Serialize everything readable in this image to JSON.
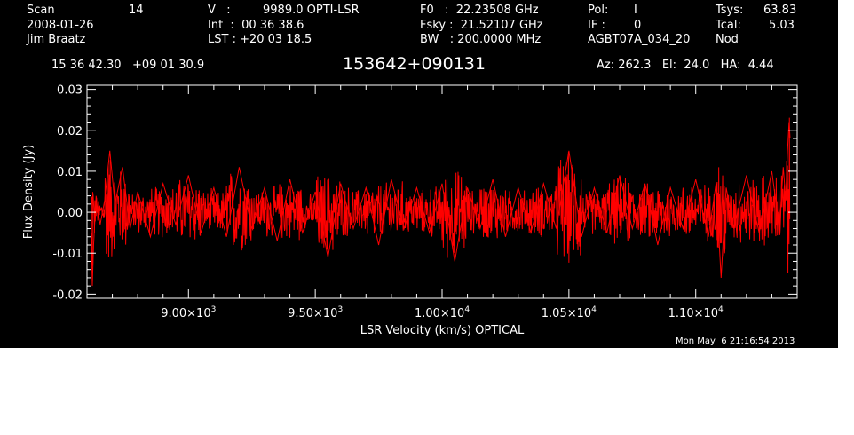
{
  "header": {
    "scan_label": "Scan",
    "scan_value": "14",
    "date": "2008-01-26",
    "observer": "Jim Braatz",
    "v_label": "V   :",
    "v_value": "9989.0 OPTI-LSR",
    "int_text": "Int  :  00 36 38.6",
    "lst_text": "LST : +20 03 18.5",
    "f0_text": "F0   :  22.23508 GHz",
    "fsky_text": "Fsky :  21.52107 GHz",
    "bw_text": "BW   : 200.0000 MHz",
    "pol_label": "Pol:",
    "pol_value": "I",
    "if_label": "IF :",
    "if_value": "0",
    "project": "AGBT07A_034_20",
    "tsys_label": "Tsys:",
    "tsys_value": "63.83",
    "tcal_label": "Tcal:",
    "tcal_value": "5.03",
    "procedure": "Nod",
    "coords": "15 36 42.30   +09 01 30.9",
    "source_name": "153642+090131",
    "az_el_ha": "Az: 262.3   El:  24.0   HA:  4.44"
  },
  "timestamp": "Mon May  6 21:16:54 2013",
  "colors": {
    "background": "#000000",
    "axes": "#ffffff",
    "trace": "#ff0000"
  },
  "chart_data": {
    "type": "line",
    "title": "",
    "xlabel": "LSR Velocity (km/s) OPTICAL",
    "ylabel": "Flux Density (Jy)",
    "xlim": [
      8600,
      11400
    ],
    "ylim": [
      -0.021,
      0.031
    ],
    "x_ticks": [
      {
        "value": 9000,
        "mantissa": "9.00",
        "exp": "3"
      },
      {
        "value": 9500,
        "mantissa": "9.50",
        "exp": "3"
      },
      {
        "value": 10000,
        "mantissa": "1.00",
        "exp": "4"
      },
      {
        "value": 10500,
        "mantissa": "1.05",
        "exp": "4"
      },
      {
        "value": 11000,
        "mantissa": "1.10",
        "exp": "4"
      }
    ],
    "x_tick_separator": "×10",
    "y_ticks": [
      {
        "value": -0.02,
        "label": "-0.02"
      },
      {
        "value": -0.01,
        "label": "-0.01"
      },
      {
        "value": 0.0,
        "label": "0.00"
      },
      {
        "value": 0.01,
        "label": "0.01"
      },
      {
        "value": 0.02,
        "label": "0.02"
      },
      {
        "value": 0.03,
        "label": "0.03"
      }
    ],
    "grid": false,
    "series": [
      {
        "x": [
          8617,
          8621,
          8626,
          8631,
          8636,
          8641,
          8652,
          8670,
          8690,
          8710,
          8740,
          8770,
          8800,
          8850,
          8900,
          8950,
          9000,
          9050,
          9100,
          9150,
          9200,
          9250,
          9300,
          9350,
          9400,
          9450,
          9500,
          9550,
          9600,
          9650,
          9700,
          9750,
          9800,
          9850,
          9900,
          9950,
          10000,
          10050,
          10100,
          10150,
          10200,
          10250,
          10300,
          10350,
          10400,
          10450,
          10500,
          10550,
          10600,
          10650,
          10700,
          10750,
          10800,
          10850,
          10900,
          10950,
          11000,
          11050,
          11080,
          11100,
          11120,
          11150,
          11200,
          11250,
          11300,
          11330,
          11345,
          11355,
          11362,
          11368,
          11372
        ],
        "y": [
          -0.005,
          -0.018,
          -0.008,
          -0.002,
          0.004,
          0.001,
          -0.003,
          0.003,
          0.015,
          0.002,
          0.011,
          -0.004,
          0.005,
          -0.006,
          0.007,
          -0.003,
          0.009,
          -0.005,
          0.006,
          -0.006,
          0.011,
          -0.004,
          0.006,
          -0.007,
          0.008,
          -0.005,
          0.005,
          -0.011,
          0.007,
          -0.004,
          0.006,
          -0.008,
          0.008,
          -0.004,
          0.006,
          -0.005,
          0.007,
          -0.012,
          0.006,
          -0.004,
          0.008,
          -0.006,
          0.006,
          -0.005,
          0.007,
          -0.004,
          0.015,
          -0.006,
          0.006,
          -0.005,
          0.009,
          -0.004,
          0.007,
          -0.008,
          0.006,
          -0.004,
          0.008,
          -0.006,
          0.007,
          -0.016,
          0.006,
          -0.004,
          0.009,
          -0.005,
          0.01,
          -0.004,
          0.011,
          0.003,
          0.015,
          0.022,
          0.018
        ]
      }
    ]
  }
}
